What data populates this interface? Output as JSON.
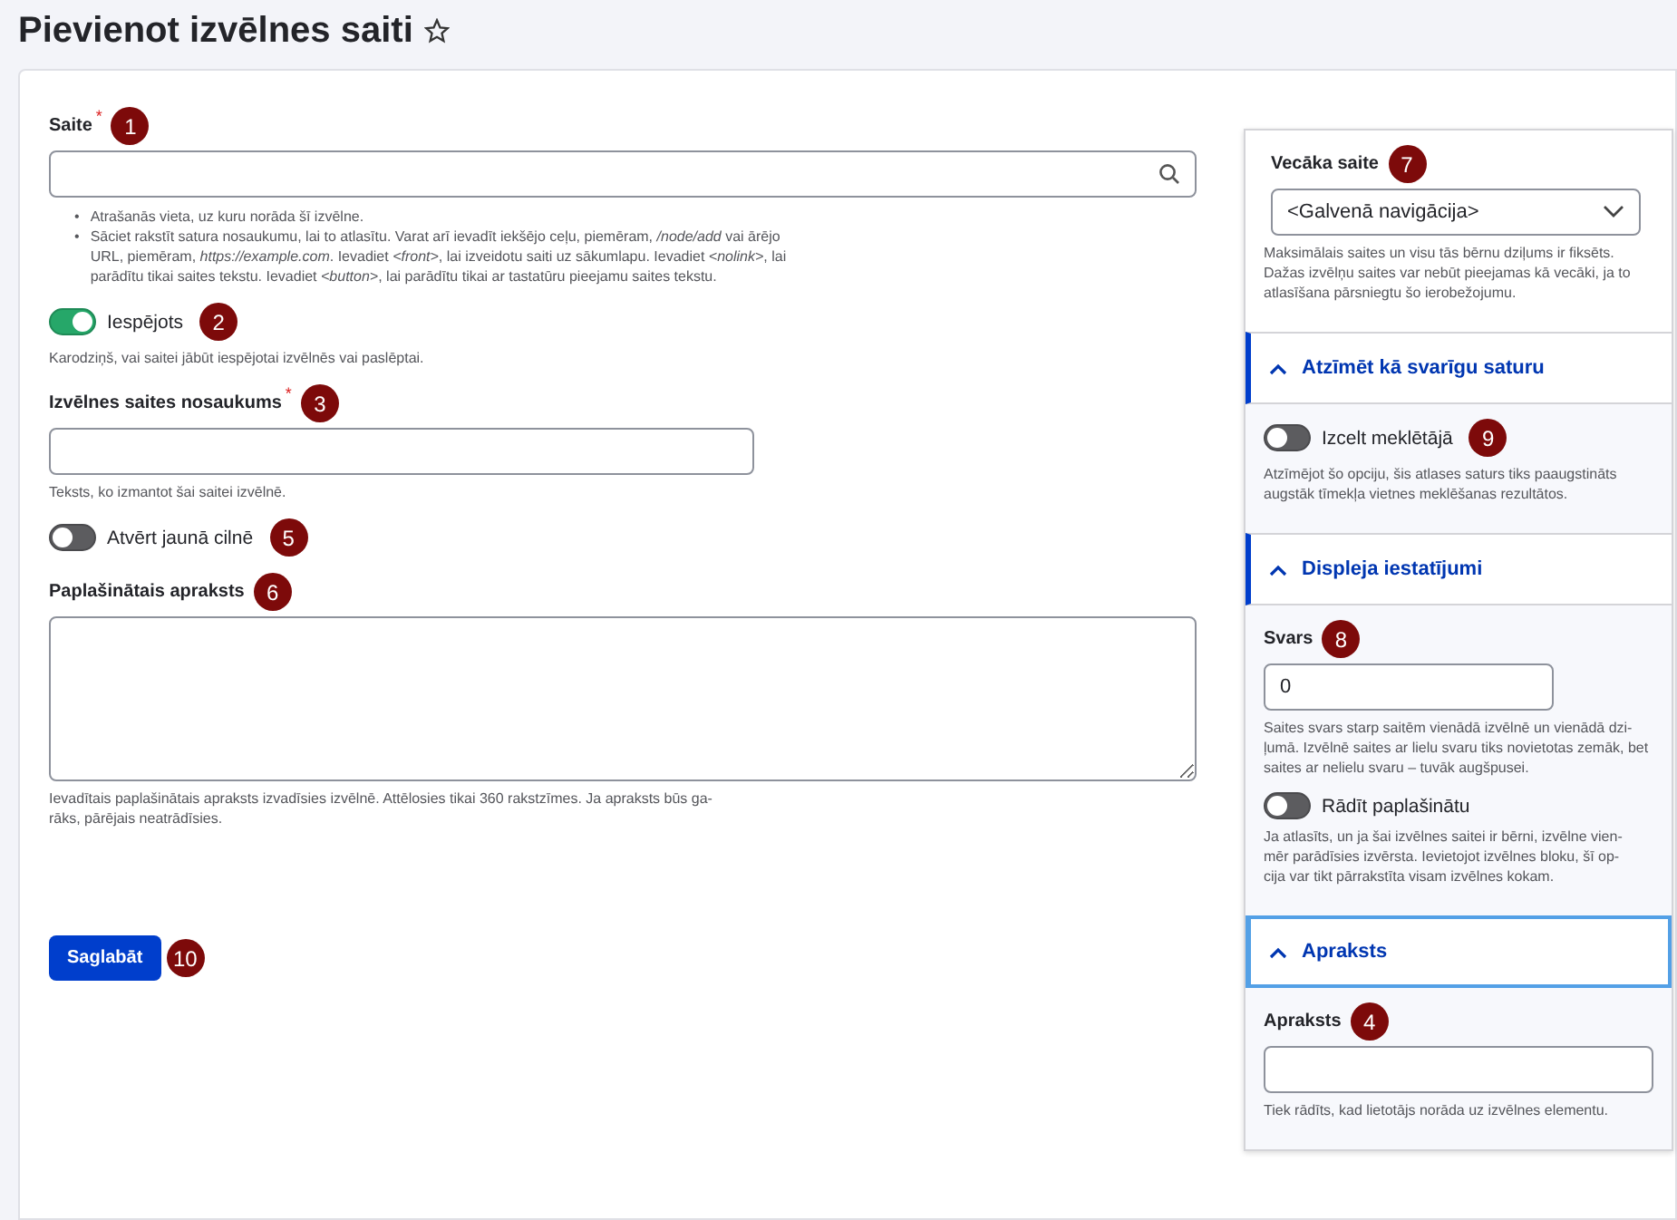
{
  "page": {
    "title": "Pievienot izvēlnes saiti",
    "favorite": false
  },
  "main_fields": [
    {
      "kind": "search",
      "label": "Saite",
      "required_mark": "*",
      "marker": "1",
      "help_list": [
        {
          "bullet": "•",
          "text": "Atrašanās vieta, uz kuru norāda šī izvēlne."
        },
        {
          "bullet": "•",
          "text": "Sāciet rakstīt satura nosaukumu, lai to atlasītu. Varat arī ievadīt iekšējo ceļu, piemēram, */node/add* vai ārējo URL, piemēram, *https://example.com*. Ievadiet *<front>*, lai izveidotu saiti uz sākumlapu. Ievadiet *<nolink>*, lai parādītu tikai saites tekstu. Ievadiet *<button>*, lai parādītu tikai ar tastatūru pieejamu saites tekstu."
        }
      ]
    },
    {
      "kind": "toggle",
      "label": "Iespējots",
      "on": true,
      "marker": "2",
      "help": "Karodziņš, vai saitei jābūt iespējotai izvēlnēs vai paslēptai."
    },
    {
      "kind": "text",
      "label": "Izvēlnes saites nosaukums",
      "required_mark": "*",
      "marker": "3",
      "help": "Teksts, ko izmantot šai saitei izvēlnē."
    },
    {
      "kind": "toggle",
      "label": "Atvērt jaunā cilnē",
      "on": false,
      "marker": "5"
    },
    {
      "kind": "textarea",
      "label": "Paplašinātais apraksts",
      "marker": "6",
      "help": "Ievadītais paplašinātais apraksts izvadīsies izvēlnē. Attēlosies tikai 360 rakstzīmes. Ja apraksts būs ga-\nrāks, pārējais neatrādīsies."
    }
  ],
  "save_button": {
    "label": "Saglabāt",
    "marker": "10"
  },
  "sidebar": [
    {
      "items": [
        {
          "kind": "select",
          "label": "Vecāka saite",
          "marker": "7",
          "value": "<Galvenā navigācija>",
          "help": "Maksimālais saites un visu tās bērnu dziļums ir fiksēts. Dažas izvēlņu saites var nebūt pieejamas kā vecāki, ja to atlasīšana pārsniegtu šo ierobežojumu."
        }
      ]
    },
    {
      "title": "Atzīmēt kā svarīgu saturu",
      "expanded": true,
      "focused": false,
      "items": [
        {
          "kind": "toggle",
          "label": "Izcelt meklētājā",
          "on": false,
          "marker": "9",
          "help": "Atzīmējot šo opciju, šis atlases saturs tiks paaugstināts augstāk tīmekļa vietnes meklēšanas rezultātos."
        }
      ]
    },
    {
      "title": "Displeja iestatījumi",
      "expanded": true,
      "focused": false,
      "items": [
        {
          "kind": "number",
          "label": "Svars",
          "marker": "8",
          "value": "0",
          "help": "Saites svars starp saitēm vienādā izvēlnē un vienādā dzi-\nļumā. Izvēlnē saites ar lielu svaru tiks novietotas zemāk, bet saites ar nelielu svaru – tuvāk augšpusei."
        },
        {
          "kind": "toggle",
          "label": "Rādīt paplašinātu",
          "on": false,
          "help": "Ja atlasīts, un ja šai izvēlnes saitei ir bērni, izvēlne vien-\nmēr parādīsies izvērsta. Ievietojot izvēlnes bloku, šī op-\ncija var tikt pārrakstīta visam izvēlnes kokam."
        }
      ]
    },
    {
      "title": "Apraksts",
      "expanded": true,
      "focused": true,
      "items": [
        {
          "kind": "text",
          "label": "Apraksts",
          "marker": "4",
          "help": "Tiek rādīts, kad lietotājs norāda uz izvēlnes elementu."
        }
      ]
    }
  ]
}
